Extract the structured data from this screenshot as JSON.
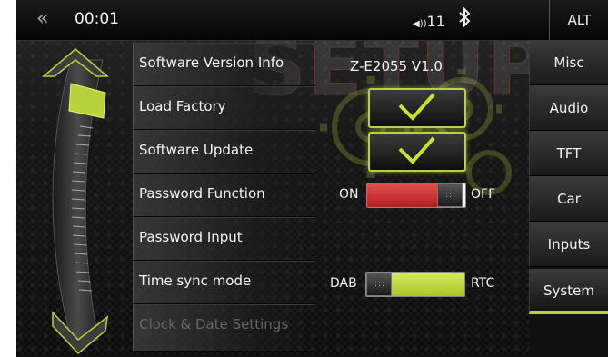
{
  "topbar": {
    "back_icon": "«",
    "time": "00:01",
    "volume_icon": "◀))",
    "volume_level": "11",
    "bluetooth_icon": "✱",
    "alt_label": "ALT"
  },
  "watermark": "SETUP",
  "rows": [
    {
      "label": "Software Version Info",
      "value": "Z-E2055 V1.0"
    },
    {
      "label": "Load Factory"
    },
    {
      "label": "Software Update"
    },
    {
      "label": "Password Function",
      "toggle_left": "ON",
      "toggle_right": "OFF"
    },
    {
      "label": "Password Input"
    },
    {
      "label": "Time sync mode",
      "toggle_left": "DAB",
      "toggle_right": "RTC"
    },
    {
      "label": "Clock & Date Settings"
    }
  ],
  "tabs": [
    {
      "label": "Misc"
    },
    {
      "label": "Audio"
    },
    {
      "label": "TFT"
    },
    {
      "label": "Car"
    },
    {
      "label": "Inputs"
    },
    {
      "label": "System"
    }
  ],
  "active_tab": "System",
  "colors": {
    "accent": "#b7d23b",
    "password_toggle": "#d42a2a",
    "time_sync_toggle": "#b7d23b"
  },
  "thumb_grip": ":::"
}
